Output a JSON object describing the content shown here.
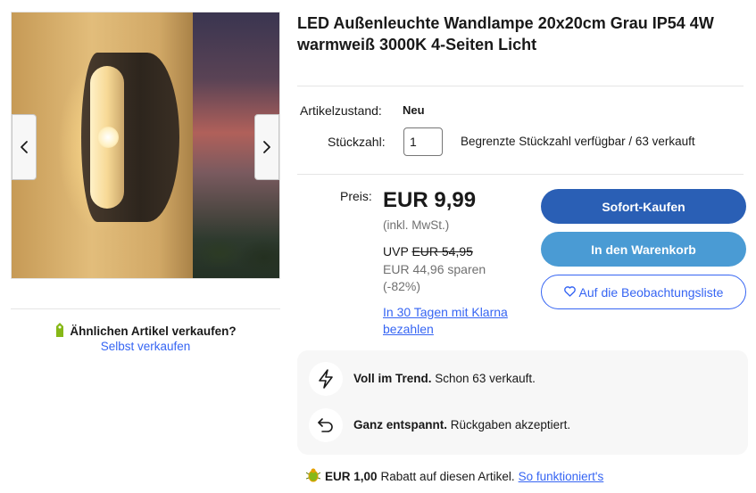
{
  "product": {
    "title": "LED Außenleuchte Wandlampe 20x20cm Grau IP54 4W warmweiß 3000K 4-Seiten Licht"
  },
  "gallery": {
    "prev_icon": "chevron-left-icon",
    "next_icon": "chevron-right-icon"
  },
  "sell": {
    "question": "Ähnlichen Artikel verkaufen?",
    "link": "Selbst verkaufen",
    "icon": "price-tag-icon"
  },
  "condition": {
    "label": "Artikelzustand:",
    "value": "Neu"
  },
  "quantity": {
    "label": "Stückzahl:",
    "value": "1",
    "note": "Begrenzte Stückzahl verfügbar / 63 verkauft"
  },
  "pricing": {
    "label": "Preis:",
    "price": "EUR 9,99",
    "vat": "(inkl. MwSt.)",
    "uvp_label": "UVP",
    "uvp_value": "EUR 54,95",
    "savings": "EUR 44,96 sparen (-82%)",
    "klarna": "In 30 Tagen mit Klarna bezahlen"
  },
  "buttons": {
    "buy_now": "Sofort-Kaufen",
    "add_to_cart": "In den Warenkorb",
    "watchlist": "Auf die Beobachtungsliste",
    "watchlist_icon": "heart-icon"
  },
  "info": {
    "trend_title": "Voll im Trend.",
    "trend_text": "Schon 63 verkauft.",
    "trend_icon": "lightning-icon",
    "returns_title": "Ganz entspannt.",
    "returns_text": "Rückgaben akzeptiert.",
    "returns_icon": "return-arrow-icon"
  },
  "rebate": {
    "amount": "EUR 1,00",
    "text": "Rabatt auf diesen Artikel.",
    "link": "So funktioniert's",
    "icon": "ebay-bug-icon"
  },
  "colors": {
    "link_blue": "#3665f3",
    "buy_button": "#2a5fb5",
    "cart_button": "#4a9bd4",
    "info_box_bg": "#f7f7f7"
  }
}
